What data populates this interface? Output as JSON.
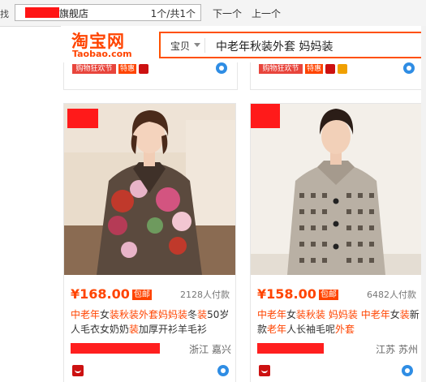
{
  "findbar": {
    "cut_label": "找",
    "query": "旗舰店",
    "count": "1个/共1个",
    "next_label": "下一个",
    "prev_label": "上一个"
  },
  "header": {
    "logo_cn": "淘宝网",
    "logo_en": "Taobao.com",
    "search_scope": "宝贝",
    "search_keyword": "中老年秋装外套 妈妈装"
  },
  "top_row": {
    "festival_label": "购物狂欢节",
    "tehui_label": "特惠"
  },
  "products": [
    {
      "price": "¥168.00",
      "post_label": "包邮",
      "deals": "2128人付款",
      "title_parts": [
        {
          "t": "中老年",
          "hl": true
        },
        {
          "t": "女",
          "hl": false
        },
        {
          "t": "装秋装外套妈妈装",
          "hl": true
        },
        {
          "t": "冬",
          "hl": false
        },
        {
          "t": "装",
          "hl": true
        },
        {
          "t": "50岁人毛衣女奶奶",
          "hl": false
        },
        {
          "t": "装",
          "hl": true
        },
        {
          "t": "加厚开衫羊毛衫",
          "hl": false
        }
      ],
      "location": "浙江 嘉兴"
    },
    {
      "price": "¥158.00",
      "post_label": "包邮",
      "deals": "6482人付款",
      "title_parts": [
        {
          "t": "中老年",
          "hl": true
        },
        {
          "t": "女",
          "hl": false
        },
        {
          "t": "装秋装",
          "hl": true
        },
        {
          "t": " ",
          "hl": false
        },
        {
          "t": "妈妈装",
          "hl": true
        },
        {
          "t": " ",
          "hl": false
        },
        {
          "t": "中老年",
          "hl": true
        },
        {
          "t": "女",
          "hl": false
        },
        {
          "t": "装",
          "hl": true
        },
        {
          "t": "新款",
          "hl": false
        },
        {
          "t": "老年",
          "hl": true
        },
        {
          "t": "人长袖毛呢",
          "hl": false
        },
        {
          "t": "外套",
          "hl": true
        }
      ],
      "location": "江苏 苏州"
    }
  ],
  "colors": {
    "brand": "#ff4400",
    "redaction": "#ff1a1a",
    "wangwang": "#2f8de4"
  }
}
